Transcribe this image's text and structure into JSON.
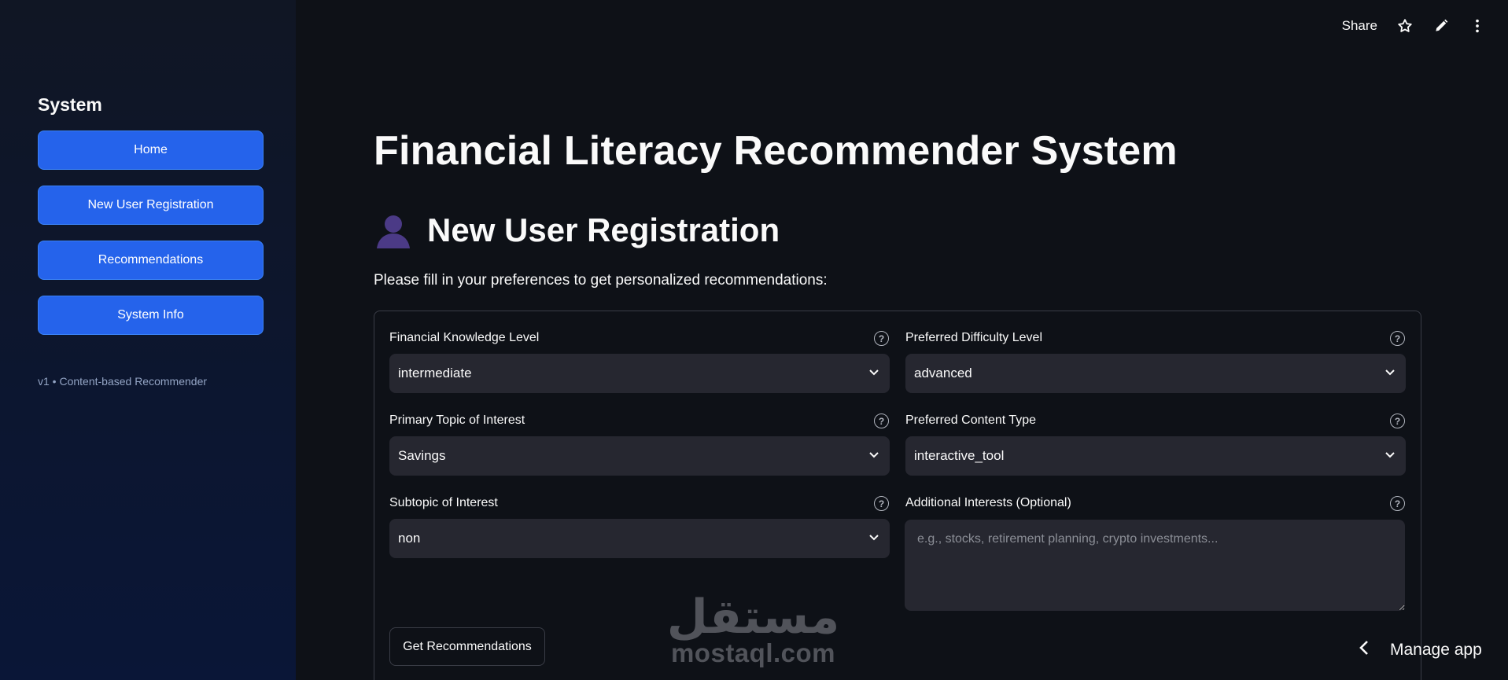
{
  "sidebar": {
    "title": "System",
    "items": [
      {
        "label": "Home"
      },
      {
        "label": "New User Registration"
      },
      {
        "label": "Recommendations"
      },
      {
        "label": "System Info"
      }
    ],
    "footer": "v1 • Content-based Recommender"
  },
  "toolbar": {
    "share_label": "Share",
    "icons": [
      "star-icon",
      "pencil-icon",
      "more-vertical-icon"
    ]
  },
  "main": {
    "title": "Financial Literacy Recommender System",
    "section_title": "New User Registration",
    "section_icon": "user-silhouette-icon",
    "intro": "Please fill in your preferences to get personalized recommendations:",
    "fields": {
      "knowledge": {
        "label": "Financial Knowledge Level",
        "value": "intermediate"
      },
      "difficulty": {
        "label": "Preferred Difficulty Level",
        "value": "advanced"
      },
      "topic": {
        "label": "Primary Topic of Interest",
        "value": "Savings"
      },
      "content_type": {
        "label": "Preferred Content Type",
        "value": "interactive_tool"
      },
      "subtopic": {
        "label": "Subtopic of Interest",
        "value": "non"
      },
      "additional": {
        "label": "Additional Interests (Optional)",
        "placeholder": "e.g., stocks, retirement planning, crypto investments..."
      }
    },
    "submit_label": "Get Recommendations"
  },
  "watermark": {
    "arabic": "مستقل",
    "latin": "mostaql.com"
  },
  "manage_app_label": "Manage app",
  "colors": {
    "accent": "#2563eb",
    "background": "#0e1117",
    "input": "#262730"
  }
}
